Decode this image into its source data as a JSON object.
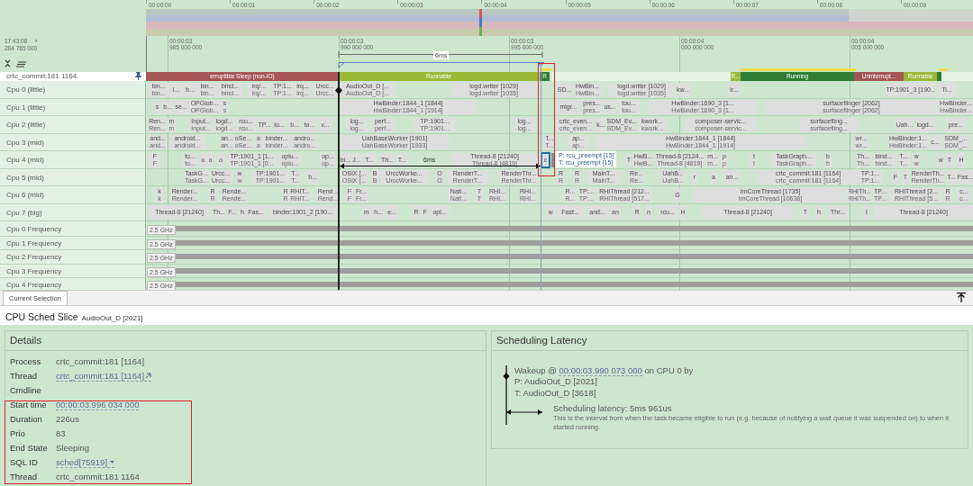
{
  "overview": {
    "ticks": [
      "00:00:00",
      "00:00:01",
      "00:00:02",
      "00:00:03",
      "00:00:04",
      "00:00:05",
      "00:00:06",
      "00:00:07",
      "00:00:08",
      "00:00:09"
    ]
  },
  "timeline": {
    "origin_time": "17:43:08",
    "origin_plus": "+",
    "origin_offset": "284 765 000",
    "markers": [
      {
        "time": "00:00:03",
        "ns": "985 000 000"
      },
      {
        "time": "00:00:03",
        "ns": "990 000 000"
      },
      {
        "time": "00:00:03",
        "ns": "995 000 000"
      },
      {
        "time": "00:00:04",
        "ns": "000 000 000"
      },
      {
        "time": "00:00:04",
        "ns": "005 000 000"
      }
    ],
    "span_label": "6ms"
  },
  "pinned_track": {
    "name": "crtc_commit:181 1164",
    "pinned": true,
    "states": [
      {
        "label": "erruptible Sleep (non-IO)",
        "kind": "sleeping"
      },
      {
        "label": "Runnable",
        "kind": "runnable"
      },
      {
        "label": "R",
        "kind": "running"
      },
      {
        "label": "R...",
        "kind": "runnable"
      },
      {
        "label": "Running",
        "kind": "running"
      },
      {
        "label": "Uninterrupt...",
        "kind": "sleeping"
      },
      {
        "label": "Runnable",
        "kind": "runnable"
      },
      {
        "kind": "running"
      }
    ]
  },
  "cpu_tracks": [
    {
      "name": "Cpu 0 (little)",
      "slices": [
        {
          "label": "bin...",
          "sub": "bin..."
        },
        {
          "label": "i..."
        },
        {
          "label": "b..."
        },
        {
          "label": "bin...",
          "sub": "bin..."
        },
        {
          "label": "bind...",
          "sub": "bind..."
        },
        {
          "label": "irq/...",
          "sub": "irq/..."
        },
        {
          "label": "TP:1...",
          "sub": "TP:1..."
        },
        {
          "label": "irq...",
          "sub": "irq..."
        },
        {
          "label": "Urcc...",
          "sub": "Urcc..."
        },
        {
          "label": "AudioOut_D [...",
          "sub": "AudioOut_D [..."
        },
        {
          "label": "logd.writer [1029]",
          "sub": "logd.writer [1035]"
        },
        {
          "label": "SD..."
        },
        {
          "label": "HwBin...",
          "sub": "HwBin..."
        },
        {
          "label": "logd.writer [1029]",
          "sub": "logd.writer [1035]"
        },
        {
          "label": "kw..."
        },
        {
          "label": "ir..."
        },
        {
          "label": "TP:1901_3 [190..."
        },
        {
          "label": "Ti..."
        }
      ]
    },
    {
      "name": "Cpu 1 (little)",
      "slices": [
        {
          "label": "s"
        },
        {
          "label": "b..."
        },
        {
          "label": "se..."
        },
        {
          "label": "OPGlob...",
          "sub": "OPGlob..."
        },
        {
          "label": "s",
          "sub": "s"
        },
        {
          "label": "HwBinder:1844_1 [1844]",
          "sub": "HwBinder:1844_1 [1914]"
        },
        {
          "label": "migr..."
        },
        {
          "label": "pres...",
          "sub": "pres..."
        },
        {
          "label": "us..."
        },
        {
          "label": "tou...",
          "sub": "tou..."
        },
        {
          "label": "HwBinder:1690_3 [1...",
          "sub": "HwBinder:1690_3 [1..."
        },
        {
          "label": "surfaceflinger [2062]",
          "sub": "surfaceflinger [2062]"
        },
        {
          "label": "HwBinder...",
          "sub": "HwBinder..."
        }
      ]
    },
    {
      "name": "Cpu 2 (little)",
      "slices": [
        {
          "label": "Ren...",
          "sub": "Ren..."
        },
        {
          "label": "m",
          "sub": "m"
        },
        {
          "label": "Input...",
          "sub": "Input..."
        },
        {
          "label": "logd...",
          "sub": "logd..."
        },
        {
          "label": "rcu...",
          "sub": "rcu..."
        },
        {
          "label": "TP..."
        },
        {
          "label": "lo..."
        },
        {
          "label": "b..."
        },
        {
          "label": "to..."
        },
        {
          "label": "v..."
        },
        {
          "label": "log...",
          "sub": "log..."
        },
        {
          "label": "perf...",
          "sub": "perf..."
        },
        {
          "label": "TP:1901...",
          "sub": "TP:1901..."
        },
        {
          "label": "log...",
          "sub": "log..."
        },
        {
          "label": "crtc_even...",
          "sub": "crtc_even..."
        },
        {
          "label": "k..."
        },
        {
          "label": "SDM_Ev...",
          "sub": "SDM_Ev..."
        },
        {
          "label": "kwork...",
          "sub": "kwork..."
        },
        {
          "label": "composer-servic...",
          "sub": "composer-servic..."
        },
        {
          "label": "surfacefling...",
          "sub": "surfacefling..."
        },
        {
          "label": "Uah..."
        },
        {
          "label": "logd..."
        },
        {
          "label": "pre..."
        }
      ]
    },
    {
      "name": "Cpu 3 (mid)",
      "slices": [
        {
          "label": "and...",
          "sub": "and..."
        },
        {
          "label": "android...",
          "sub": "android..."
        },
        {
          "label": "an...",
          "sub": "an..."
        },
        {
          "label": "oSe...",
          "sub": "oSe..."
        },
        {
          "label": "a",
          "sub": "a"
        },
        {
          "label": "binder...",
          "sub": "binder..."
        },
        {
          "label": "andro...",
          "sub": "andro..."
        },
        {
          "label": "UahBaseWorker [1901]",
          "sub": "UahBaseWorker [1933]"
        },
        {
          "label": "T...",
          "sub": "T..."
        },
        {
          "label": "ap...",
          "sub": "ap..."
        },
        {
          "label": "HwBinder:1844_1 [1844]",
          "sub": "HwBinder:1844_1 [1914]"
        },
        {
          "label": "wr...",
          "sub": "wr..."
        },
        {
          "label": "HwBinder:1...",
          "sub": "HwBinder:1..."
        },
        {
          "label": "c..."
        },
        {
          "label": "SDM_...",
          "sub": "SDM_..."
        }
      ]
    },
    {
      "name": "Cpu 4 (mid)",
      "slices": [
        {
          "label": "F",
          "sub": "F"
        },
        {
          "label": "to...",
          "sub": "to..."
        },
        {
          "label": "o"
        },
        {
          "label": "o"
        },
        {
          "label": "o"
        },
        {
          "label": "TP:1901_1 [1...",
          "sub": "TP:1901_1 [0..."
        },
        {
          "label": "oplu...",
          "sub": "oplu..."
        },
        {
          "label": "op...",
          "sub": "op..."
        },
        {
          "label": "bi..."
        },
        {
          "label": "J..."
        },
        {
          "label": "T..."
        },
        {
          "label": "Th..."
        },
        {
          "label": "T..."
        },
        {
          "label": "Thread-8 [21240]",
          "sub": "Thread-8 [4819]"
        },
        {
          "label": "T"
        },
        {
          "label": "HwB...",
          "sub": "HwB..."
        },
        {
          "label": "Thread-8 [2124...",
          "sub": "Thread-8 [4819]"
        },
        {
          "label": "m...",
          "sub": "m..."
        },
        {
          "label": "p",
          "sub": "p"
        },
        {
          "label": "t",
          "sub": "t"
        },
        {
          "label": "TaskGraph...",
          "sub": "TaskGraph..."
        },
        {
          "label": "b",
          "sub": "b"
        },
        {
          "label": "Th...",
          "sub": "Th..."
        },
        {
          "label": "bind...",
          "sub": "bind..."
        },
        {
          "label": "T...",
          "sub": "T..."
        },
        {
          "label": "w",
          "sub": "w"
        },
        {
          "label": "w"
        },
        {
          "label": "T"
        },
        {
          "label": "H"
        }
      ],
      "selected_slice": {
        "label": "c"
      }
    },
    {
      "name": "Cpu 5 (mid)",
      "slices": [
        {
          "label": "TaskG...",
          "sub": "TaskG..."
        },
        {
          "label": "Urcc...",
          "sub": "Urcc..."
        },
        {
          "label": "w",
          "sub": "w"
        },
        {
          "label": "TP:1901...",
          "sub": "TP:1901..."
        },
        {
          "label": "T...",
          "sub": "T..."
        },
        {
          "label": "b..."
        },
        {
          "label": "OSIX [...",
          "sub": "OSIX [..."
        },
        {
          "label": "B",
          "sub": "B"
        },
        {
          "label": "UrccWorke...",
          "sub": "UrccWorke..."
        },
        {
          "label": "O",
          "sub": "O"
        },
        {
          "label": "RenderT...",
          "sub": "RenderT..."
        },
        {
          "label": "RenderThr...",
          "sub": "RenderThr..."
        },
        {
          "label": "R",
          "sub": "R"
        },
        {
          "label": "R",
          "sub": "R"
        },
        {
          "label": "MainT...",
          "sub": "MainT..."
        },
        {
          "label": "Re...",
          "sub": "Re..."
        },
        {
          "label": "UahB...",
          "sub": "UahB..."
        },
        {
          "label": "r"
        },
        {
          "label": "a"
        },
        {
          "label": "an..."
        },
        {
          "label": "crtc_commit:181 [1164]",
          "sub": "crtc_commit:181 [1164]"
        },
        {
          "label": "TP:1...",
          "sub": "TP:1..."
        },
        {
          "label": "F"
        },
        {
          "label": "T"
        },
        {
          "label": "RenderTh...",
          "sub": "RenderTh..."
        },
        {
          "label": "T..."
        },
        {
          "label": "Fas..."
        }
      ]
    },
    {
      "name": "Cpu 6 (mid)",
      "slices": [
        {
          "label": "k",
          "sub": "k"
        },
        {
          "label": "Render...",
          "sub": "Render..."
        },
        {
          "label": "R",
          "sub": "R"
        },
        {
          "label": "Rende...",
          "sub": "Rende..."
        },
        {
          "label": "R",
          "sub": "R"
        },
        {
          "label": "RHIT...",
          "sub": "RHIT..."
        },
        {
          "label": "Rend...",
          "sub": "Rend..."
        },
        {
          "label": "F",
          "sub": "F"
        },
        {
          "label": "Fr...",
          "sub": "Fr..."
        },
        {
          "label": "Nati...",
          "sub": "Nati..."
        },
        {
          "label": "T",
          "sub": "T"
        },
        {
          "label": "RHI...",
          "sub": "RHI..."
        },
        {
          "label": "RHI...",
          "sub": "RHI..."
        },
        {
          "label": "R...",
          "sub": "R..."
        },
        {
          "label": "TP:...",
          "sub": "TP:..."
        },
        {
          "label": "RHIThread [212...",
          "sub": "RHIThread [517..."
        },
        {
          "label": "G"
        },
        {
          "label": "ImCoreThread [1735]",
          "sub": "ImCoreThread [10638]"
        },
        {
          "label": "RHITh...",
          "sub": "RHITh..."
        },
        {
          "label": "TP...",
          "sub": "TP..."
        },
        {
          "label": "RHIThread [2...",
          "sub": "RHIThread [5..."
        },
        {
          "label": "R",
          "sub": "R"
        },
        {
          "label": "c...",
          "sub": "c..."
        }
      ]
    },
    {
      "name": "Cpu 7 (big)",
      "slices": [
        {
          "label": "Thread-8 [21240]"
        },
        {
          "label": "Th..."
        },
        {
          "label": "F..."
        },
        {
          "label": "h"
        },
        {
          "label": "Fas..."
        },
        {
          "label": "binder:1901_2 [190..."
        },
        {
          "label": "m"
        },
        {
          "label": "h..."
        },
        {
          "label": "e..."
        },
        {
          "label": "R"
        },
        {
          "label": "F"
        },
        {
          "label": "opl..."
        },
        {
          "label": "w"
        },
        {
          "label": "Fast..."
        },
        {
          "label": "and..."
        },
        {
          "label": "an"
        },
        {
          "label": "R"
        },
        {
          "label": "n"
        },
        {
          "label": "rcu..."
        },
        {
          "label": "H"
        },
        {
          "label": "Thread-8 [21240]"
        },
        {
          "label": "T"
        },
        {
          "label": "h"
        },
        {
          "label": "Thr..."
        },
        {
          "label": "t"
        },
        {
          "label": "Thread-8 [21240]"
        }
      ]
    }
  ],
  "freq_tracks": [
    {
      "name": "Cpu 0 Frequency",
      "reading": "2.5 GHz"
    },
    {
      "name": "Cpu 1 Frequency",
      "reading": "2.5 GHz"
    },
    {
      "name": "Cpu 2 Frequency",
      "reading": "2.5 GHz"
    },
    {
      "name": "Cpu 3 Frequency",
      "reading": "2.5 GHz"
    },
    {
      "name": "Cpu 4 Frequency",
      "reading": "2.5 GHz"
    }
  ],
  "flow_arrow": {
    "label": "6ms"
  },
  "tooltip": {
    "lines": [
      "P: rcu_preempt [15]",
      "T: rcu_preempt [15]"
    ]
  },
  "bottom_tabs": [
    {
      "label": "Current Selection",
      "selected": true
    }
  ],
  "selection": {
    "title": "CPU Sched Slice",
    "subtitle": "AudioOut_D [2021]"
  },
  "details": {
    "title": "Details",
    "rows": [
      {
        "label": "Process",
        "value": "crtc_commit:181 [1164]",
        "kind": "text"
      },
      {
        "label": "Thread",
        "value": "crtc_commit:181 [1164]",
        "kind": "external-link"
      },
      {
        "label": "Cmdline",
        "kind": "text"
      },
      {
        "label": "Start time",
        "value": "00:00:03.996 034 000",
        "kind": "link"
      },
      {
        "label": "Duration",
        "value": "226us",
        "kind": "text"
      },
      {
        "label": "Prio",
        "value": "83",
        "kind": "text"
      },
      {
        "label": "End State",
        "value": "Sleeping",
        "kind": "text"
      },
      {
        "label": "SQL ID",
        "value": "sched[75919]",
        "kind": "menu-link"
      },
      {
        "label": "Thread",
        "value": "crtc_commit:181 1164",
        "kind": "text"
      }
    ]
  },
  "latency": {
    "title": "Scheduling Latency",
    "wakeup_prefix": "Wakeup @",
    "wakeup_time": "00:00:03.990 073 000",
    "wakeup_suffix": "on CPU 0 by",
    "process": "P: AudioOut_D [2021]",
    "thread": "T: AudioOut_D [3618]",
    "latency": "Scheduling latency: 5ms 961us",
    "description": "This is the interval from when the task became eligible to run (e.g. because of notifying a wait queue it was suspended on) to when it started running."
  }
}
